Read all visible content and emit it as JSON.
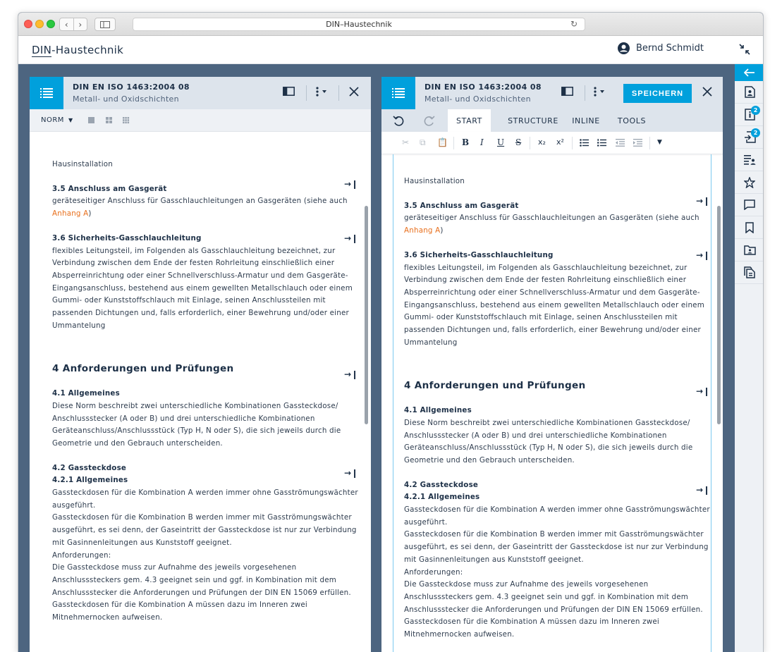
{
  "browser": {
    "url": "DIN–Haustechnik"
  },
  "app": {
    "brand_prefix": "DIN",
    "brand_suffix": "-Haustechnik",
    "user": "Bernd Schmidt"
  },
  "left_doc": {
    "title": "DIN EN ISO 1463:2004 08",
    "subtitle": "Metall- und Oxidschichten",
    "norm_label": "NORM"
  },
  "right_doc": {
    "title": "DIN EN ISO 1463:2004 08",
    "subtitle": "Metall- und Oxidschichten",
    "save_label": "SPEICHERN",
    "tabs": [
      "START",
      "STRUCTURE",
      "INLINE",
      "TOOLS"
    ]
  },
  "toolbar": {
    "bold": "B",
    "italic": "I",
    "underline": "U",
    "strike": "S",
    "subscript": "x₂",
    "superscript": "x²"
  },
  "jump_glyph": "→❙",
  "content": {
    "intro": "Hausinstallation",
    "s35_title": "3.5 Anschluss am Gasgerät",
    "s35_lines": [
      "geräteseitiger Anschluss für Gasschlauchleitungen an Gasgeräten (siehe auch"
    ],
    "s35_link": "Anhang A",
    "s36_title": "3.6 Sicherheits-Gasschlauchleitung",
    "s36_lines": [
      "flexibles Leitungsteil, im Folgenden als Gasschlauchleitung bezeichnet, zur",
      "Verbindung zwischen dem Ende der festen Rohrleitung einschließlich einer",
      "Absperreinrichtung oder einer Schnellverschluss-Armatur und dem Gasgeräte-",
      "Eingangsanschluss, bestehend aus einem gewellten Metallschlauch oder einem",
      "Gummi- oder Kunststoffschlauch mit Einlage, seinen Anschlussteilen mit",
      "passenden Dichtungen und, falls erforderlich, einer Bewehrung und/oder einer",
      "Ummantelung"
    ],
    "s4_title": "4 Anforderungen und Prüfungen",
    "s41_title": "4.1 Allgemeines",
    "s41_lines": [
      "Diese Norm beschreibt zwei unterschiedliche Kombinationen Gassteckdose/",
      "Anschlussstecker (A oder B) und drei unterschiedliche Kombinationen",
      "Geräteanschluss/Anschlussstück (Typ H, N oder S), die sich jeweils durch die",
      "Geometrie und den Gebrauch unterscheiden."
    ],
    "s42_title": "4.2 Gassteckdose",
    "s421_title": "4.2.1 Allgemeines",
    "s421_lines": [
      "Gassteckdosen für die Kombination A werden immer ohne Gasströmungswächter",
      "ausgeführt.",
      "Gassteckdosen für die Kombination B werden immer mit Gasströmungswächter",
      "ausgeführt, es sei denn, der Gaseintritt der Gassteckdose ist nur zur Verbindung",
      "mit Gasinnenleitungen aus Kunststoff geeignet.",
      "Anforderungen:",
      "Die Gassteckdose muss zur Aufnahme des jeweils vorgesehenen",
      "Anschlusssteckers gem. 4.3 geeignet sein und ggf. in Kombination mit dem",
      "Anschlussstecker die Anforderungen und Prüfungen der DIN EN 15069 erfüllen.",
      "Gassteckdosen für die Kombination A müssen dazu im Inneren zwei",
      "Mitnehmernocken aufweisen."
    ]
  },
  "rail": {
    "badge_info": "2",
    "badge_export": "2"
  }
}
